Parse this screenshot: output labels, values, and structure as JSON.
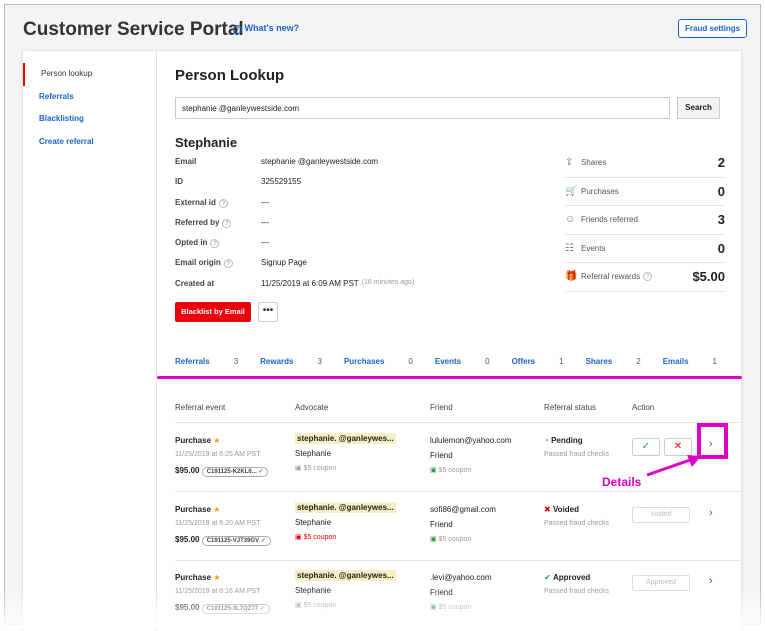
{
  "header": {
    "title": "Customer Service Portal",
    "whats_new": "What's new?",
    "fraud_settings": "Fraud settings"
  },
  "sidebar": {
    "items": [
      {
        "label": "Person lookup",
        "active": true
      },
      {
        "label": "Referrals"
      },
      {
        "label": "Blacklisting"
      },
      {
        "label": "Create referral"
      }
    ]
  },
  "lookup": {
    "title": "Person Lookup",
    "search_value": "stephanie   @ganleywestside.com",
    "search_button": "Search"
  },
  "person": {
    "name": "Stephanie",
    "fields": [
      {
        "label": "Email",
        "value": "stephanie   @ganleywestside.com",
        "help": false
      },
      {
        "label": "ID",
        "value": "325529155",
        "help": false
      },
      {
        "label": "External id",
        "value": "—",
        "help": true
      },
      {
        "label": "Referred by",
        "value": "—",
        "help": true
      },
      {
        "label": "Opted in",
        "value": "—",
        "help": true
      },
      {
        "label": "Email origin",
        "value": "Signup Page",
        "help": true
      },
      {
        "label": "Created at",
        "value": "11/25/2019 at 6:09 AM PST",
        "note": "(16 minutes ago)",
        "help": false
      }
    ],
    "blacklist_button": "Blacklist by Email",
    "more_button": "•••"
  },
  "stats": [
    {
      "icon": "share-icon",
      "label": "Shares",
      "value": "2"
    },
    {
      "icon": "cart-icon",
      "label": "Purchases",
      "value": "0"
    },
    {
      "icon": "friends-icon",
      "label": "Friends referred",
      "value": "3"
    },
    {
      "icon": "events-icon",
      "label": "Events",
      "value": "0"
    },
    {
      "icon": "gift-icon",
      "label": "Referral rewards",
      "value": "$5.00"
    }
  ],
  "tabs": [
    {
      "label": "Referrals",
      "count": "3"
    },
    {
      "label": "Rewards",
      "count": "3"
    },
    {
      "label": "Purchases",
      "count": "0"
    },
    {
      "label": "Events",
      "count": "0"
    },
    {
      "label": "Offers",
      "count": "1"
    },
    {
      "label": "Shares",
      "count": "2"
    },
    {
      "label": "Emails",
      "count": "1"
    }
  ],
  "table": {
    "headers": [
      "Referral event",
      "Advocate",
      "Friend",
      "Referral status",
      "Action"
    ],
    "rows": [
      {
        "event": "Purchase",
        "time": "11/25/2019 at 6:25 AM PST",
        "amount": "$95.00",
        "code": "C191125-K2KL6...",
        "advocate_email": "stephanie.  @ganleywes...",
        "advocate_name": "Stephanie",
        "advocate_reward": "$5 coupon",
        "friend_email": "lululemon@yahoo.com",
        "friend_name": "Friend",
        "friend_reward": "$5 coupon",
        "status": "Pending",
        "fraud": "Passed fraud checks",
        "action": "approve-deny"
      },
      {
        "event": "Purchase",
        "time": "11/25/2019 at 6:20 AM PST",
        "amount": "$95.00",
        "code": "C191125-VJT39GV",
        "advocate_email": "stephanie.  @ganleywes...",
        "advocate_name": "Stephanie",
        "advocate_reward": "$5 coupon",
        "friend_email": "sofi86@gmail.com",
        "friend_name": "Friend",
        "friend_reward": "$5 coupon",
        "status": "Voided",
        "fraud": "Passed fraud checks",
        "action": "Voided"
      },
      {
        "event": "Purchase",
        "time": "11/25/2019 at 6:16 AM PST",
        "amount": "$95.00",
        "code": "C191125-3L7QZ77",
        "advocate_email": "stephanie.  @ganleywes...",
        "advocate_name": "Stephanie",
        "advocate_reward": "$5 coupon",
        "friend_email": "    .levi@yahoo.com",
        "friend_name": "Friend",
        "friend_reward": "$5 coupon",
        "status": "Approved",
        "fraud": "Passed fraud checks",
        "action": "Approved"
      }
    ]
  },
  "annotation": {
    "label": "Details",
    "color": "#e000c8"
  }
}
